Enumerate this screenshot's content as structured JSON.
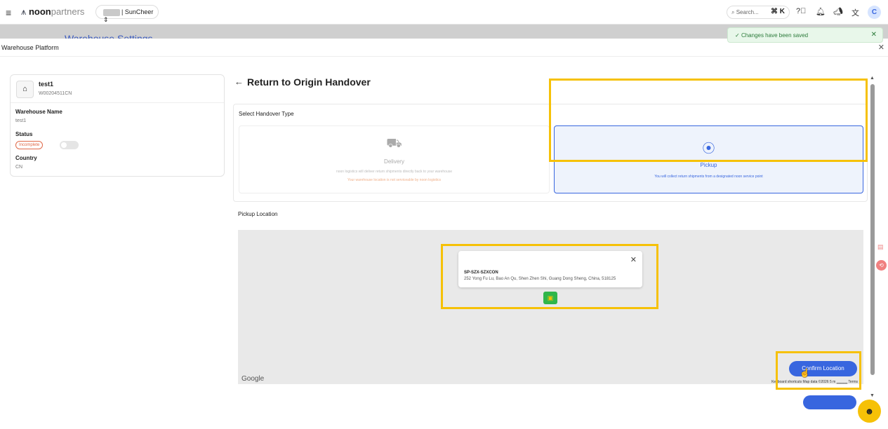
{
  "topbar": {
    "brand_noon": "noon",
    "brand_partners": "partners",
    "store_name": "| SunCheer ⇕",
    "search_placeholder": "Search...",
    "search_shortcut": "⌘ K",
    "avatar_letter": "C"
  },
  "behind_title": "Warehouse Settings",
  "toast": {
    "message": "Changes have been saved"
  },
  "panel": {
    "title": "Warehouse Platform"
  },
  "warehouse": {
    "name": "test1",
    "code": "W00204511CN",
    "name_label": "Warehouse Name",
    "name_value": "test1",
    "status_label": "Status",
    "status_value": "Incomplete",
    "country_label": "Country",
    "country_value": "CN"
  },
  "main": {
    "title": "Return to Origin Handover",
    "handover_label": "Select Handover Type",
    "delivery": {
      "title": "Delivery",
      "desc": "noon logistics will deliver return shipments directly back to your warehouse",
      "warning": "Your warehouse location is not serviceable by noon logistics"
    },
    "pickup": {
      "title": "Pickup",
      "desc": "You will collect return shipments from a designated noon service point"
    },
    "pickup_location_label": "Pickup Location"
  },
  "map": {
    "popup_code": "SP-SZX-SZXCON",
    "popup_address": "252 Yong Fu Lu, Bao An Qu, Shen Zhen Shi, Guang Dong Sheng, China, 518125",
    "google_label": "Google",
    "attribution": "Keyboard shortcuts   Map data ©2026   5 m ▁▁▁▁   Terms",
    "confirm_label": "Confirm Location"
  },
  "colors": {
    "accent": "#3866df",
    "highlight": "#f6c107",
    "toast_bg": "#e8f7ea"
  }
}
